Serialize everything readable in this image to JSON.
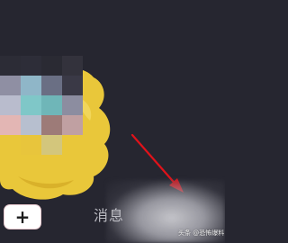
{
  "screen": {
    "background": "#262630"
  },
  "tab_bar": {
    "add_button_label": "+",
    "messages_label": "消息"
  },
  "annotation": {
    "arrow_color": "#e0121a",
    "arrow_icon": "red-arrow"
  },
  "sticker": {
    "color": "#e9c73a"
  },
  "watermark": "头条 @恐怖爆料"
}
